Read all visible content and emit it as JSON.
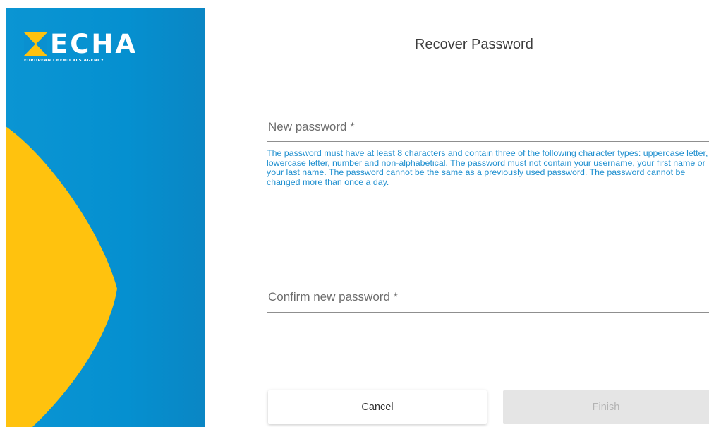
{
  "brand": {
    "name": "ECHA",
    "tagline": "EUROPEAN CHEMICALS AGENCY",
    "colors": {
      "blue": "#0a90d0",
      "yellow": "#ffc20e"
    }
  },
  "form": {
    "title": "Recover Password",
    "new_password": {
      "placeholder": "New password *",
      "value": ""
    },
    "hint": "The password must have at least 8 characters and contain three of the following character types: uppercase letter, lowercase letter, number and non-alphabetical. The password must not contain your username, your first name or your last name. The password cannot be the same as a previously used password. The password cannot be changed more than once a day.",
    "confirm_password": {
      "placeholder": "Confirm new password *",
      "value": ""
    },
    "buttons": {
      "cancel": "Cancel",
      "finish": "Finish"
    }
  }
}
